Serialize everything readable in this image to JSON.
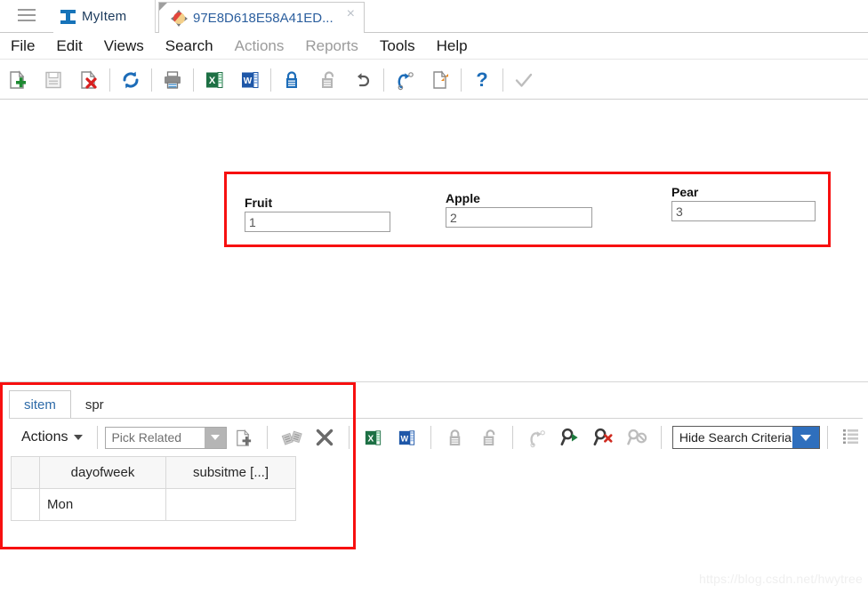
{
  "window": {
    "hamburger_icon": "hamburger-menu-icon",
    "app_tab": {
      "label": "MyItem",
      "icon": "ibeam-logo-icon"
    },
    "document_tab": {
      "label": "97E8D618E58A41ED...",
      "icon": "record-sphere-icon",
      "close_label": "×"
    }
  },
  "menubar": {
    "items": [
      {
        "label": "File",
        "disabled": false
      },
      {
        "label": "Edit",
        "disabled": false
      },
      {
        "label": "Views",
        "disabled": false
      },
      {
        "label": "Search",
        "disabled": false
      },
      {
        "label": "Actions",
        "disabled": true
      },
      {
        "label": "Reports",
        "disabled": true
      },
      {
        "label": "Tools",
        "disabled": false
      },
      {
        "label": "Help",
        "disabled": false
      }
    ]
  },
  "toolbar": {
    "buttons": [
      {
        "name": "new-record-icon",
        "enabled": true
      },
      {
        "name": "save-icon",
        "enabled": false
      },
      {
        "name": "delete-record-icon",
        "enabled": true
      },
      {
        "name": "refresh-icon",
        "enabled": true
      },
      {
        "name": "print-icon",
        "enabled": true
      },
      {
        "name": "export-excel-icon",
        "enabled": true
      },
      {
        "name": "export-word-icon",
        "enabled": true
      },
      {
        "name": "lock-icon",
        "enabled": true
      },
      {
        "name": "unlock-icon",
        "enabled": false
      },
      {
        "name": "undo-icon",
        "enabled": true
      },
      {
        "name": "redo-icon",
        "enabled": true
      },
      {
        "name": "copy-icon",
        "enabled": true
      },
      {
        "name": "help-icon",
        "enabled": true
      },
      {
        "name": "check-icon",
        "enabled": false
      }
    ]
  },
  "form": {
    "highlight_color": "#f71010",
    "fields": [
      {
        "label": "Fruit",
        "value": "1"
      },
      {
        "label": "Apple",
        "value": "2"
      },
      {
        "label": "Pear",
        "value": "3"
      }
    ]
  },
  "bottom_panel": {
    "tabs": [
      {
        "label": "sitem",
        "active": true
      },
      {
        "label": "spr",
        "active": false
      }
    ],
    "actions_label": "Actions",
    "pick_related": {
      "value": "Pick Related"
    },
    "buttons": [
      {
        "name": "new-row-icon",
        "enabled": true
      },
      {
        "name": "link-related-icon",
        "enabled": false
      },
      {
        "name": "remove-row-icon",
        "enabled": true
      },
      {
        "name": "export-excel-icon",
        "enabled": true
      },
      {
        "name": "export-word-icon",
        "enabled": true
      },
      {
        "name": "lock-icon",
        "enabled": false
      },
      {
        "name": "unlock-icon",
        "enabled": false
      },
      {
        "name": "redo-icon",
        "enabled": false
      },
      {
        "name": "run-search-icon",
        "enabled": true
      },
      {
        "name": "clear-search-icon",
        "enabled": true
      },
      {
        "name": "disable-search-icon",
        "enabled": false
      }
    ],
    "hide_search_criteria": {
      "label": "Hide Search Criteria"
    },
    "grid": {
      "columns": [
        "",
        "dayofweek",
        "subsitme [...]"
      ],
      "rows": [
        {
          "cells": [
            "",
            "Mon",
            ""
          ]
        }
      ]
    }
  },
  "watermark": {
    "text": "https://blog.csdn.net/hwytree"
  }
}
